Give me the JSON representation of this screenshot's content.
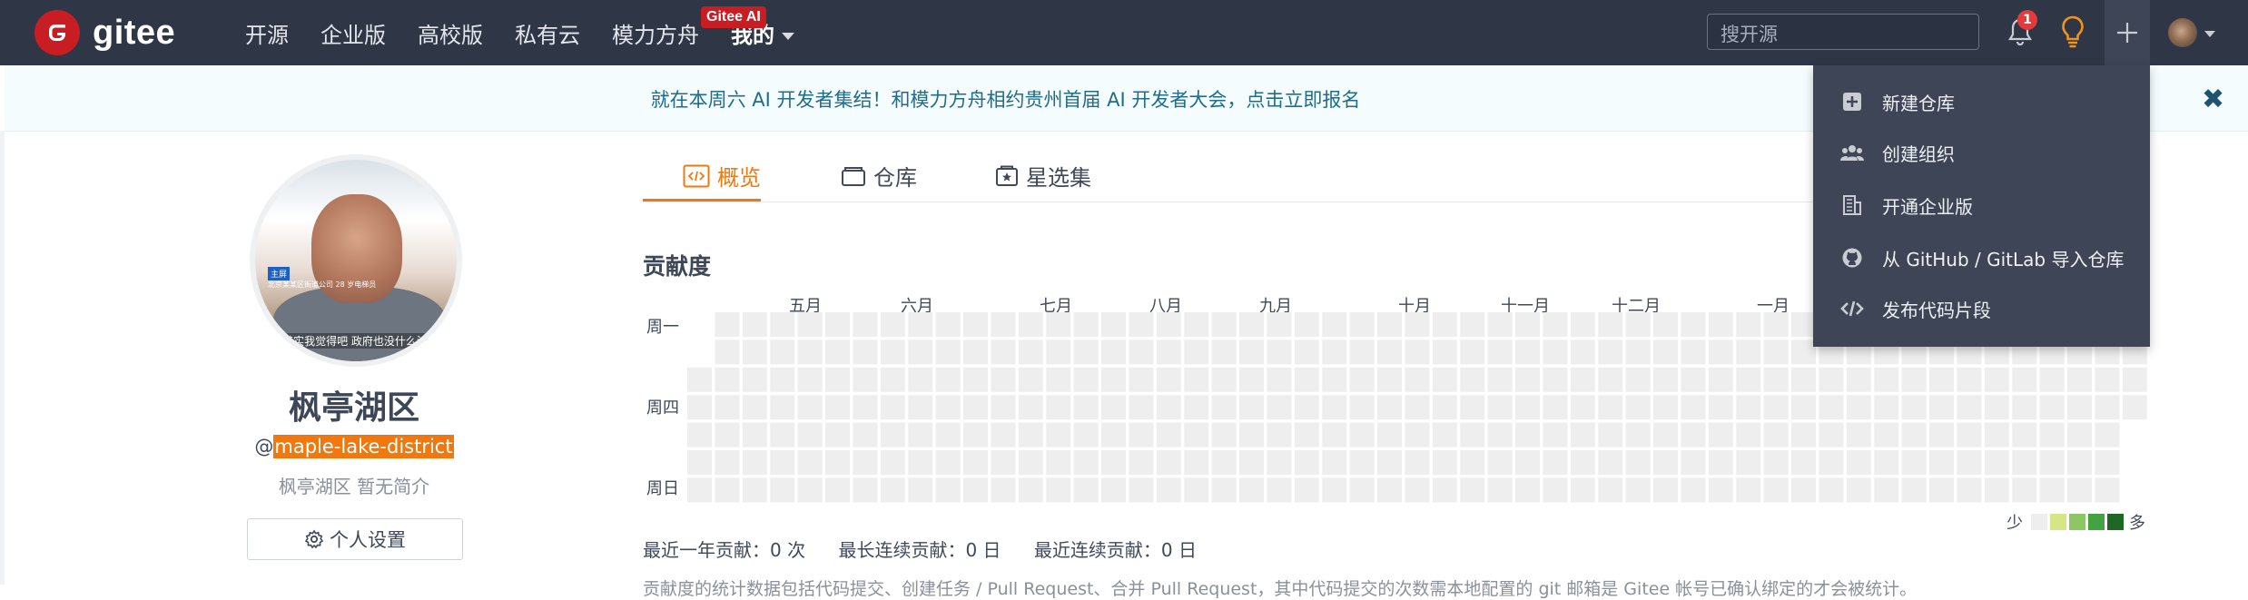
{
  "brand": {
    "logo_letter": "G",
    "name": "gitee",
    "color": "#c71d23"
  },
  "nav": {
    "items": [
      "开源",
      "企业版",
      "高校版",
      "私有云",
      "模力方舟",
      "我的"
    ],
    "badge": "Gitee AI"
  },
  "search": {
    "placeholder": "搜开源"
  },
  "notifications": {
    "count": "1"
  },
  "banner": {
    "text": "就在本周六 AI 开发者集结！和模力方舟相约贵州首届 AI 开发者大会，点击立即报名",
    "close": "✖"
  },
  "profile": {
    "name": "枫亭湖区",
    "at": "@",
    "username": "maple-lake-district",
    "bio": "枫亭湖区 暂无简介",
    "settings_label": "个人设置",
    "photo_tag": "主屏",
    "photo_subtag": "北京某某区街道公司 28 岁电梯员",
    "photo_caption": "其实我觉得吧 政府也没什么法"
  },
  "tabs": [
    "概览",
    "仓库",
    "星选集"
  ],
  "contributions": {
    "title": "贡献度",
    "months": [
      "五月",
      "六月",
      "七月",
      "八月",
      "九月",
      "十月",
      "十一月",
      "十二月",
      "一月"
    ],
    "day_labels": [
      "周一",
      "周四",
      "周日"
    ],
    "legend_less": "少",
    "legend_more": "多",
    "levels": [
      "#eeeeee",
      "#d6e685",
      "#8cc665",
      "#44a340",
      "#1e6823"
    ],
    "stats": [
      "最近一年贡献：0 次",
      "最长连续贡献：0 日",
      "最近连续贡献：0 日"
    ],
    "footnote": "贡献度的统计数据包括代码提交、创建任务 / Pull Request、合并 Pull Request，其中代码提交的次数需本地配置的 git 邮箱是 Gitee 帐号已确认绑定的才会被统计。"
  },
  "create_menu": {
    "items": [
      {
        "label": "新建仓库",
        "icon": "plus-square-icon"
      },
      {
        "label": "创建组织",
        "icon": "users-icon"
      },
      {
        "label": "开通企业版",
        "icon": "building-icon"
      },
      {
        "label": "从 GitHub / GitLab 导入仓库",
        "icon": "github-icon"
      },
      {
        "label": "发布代码片段",
        "icon": "code-icon"
      }
    ]
  }
}
